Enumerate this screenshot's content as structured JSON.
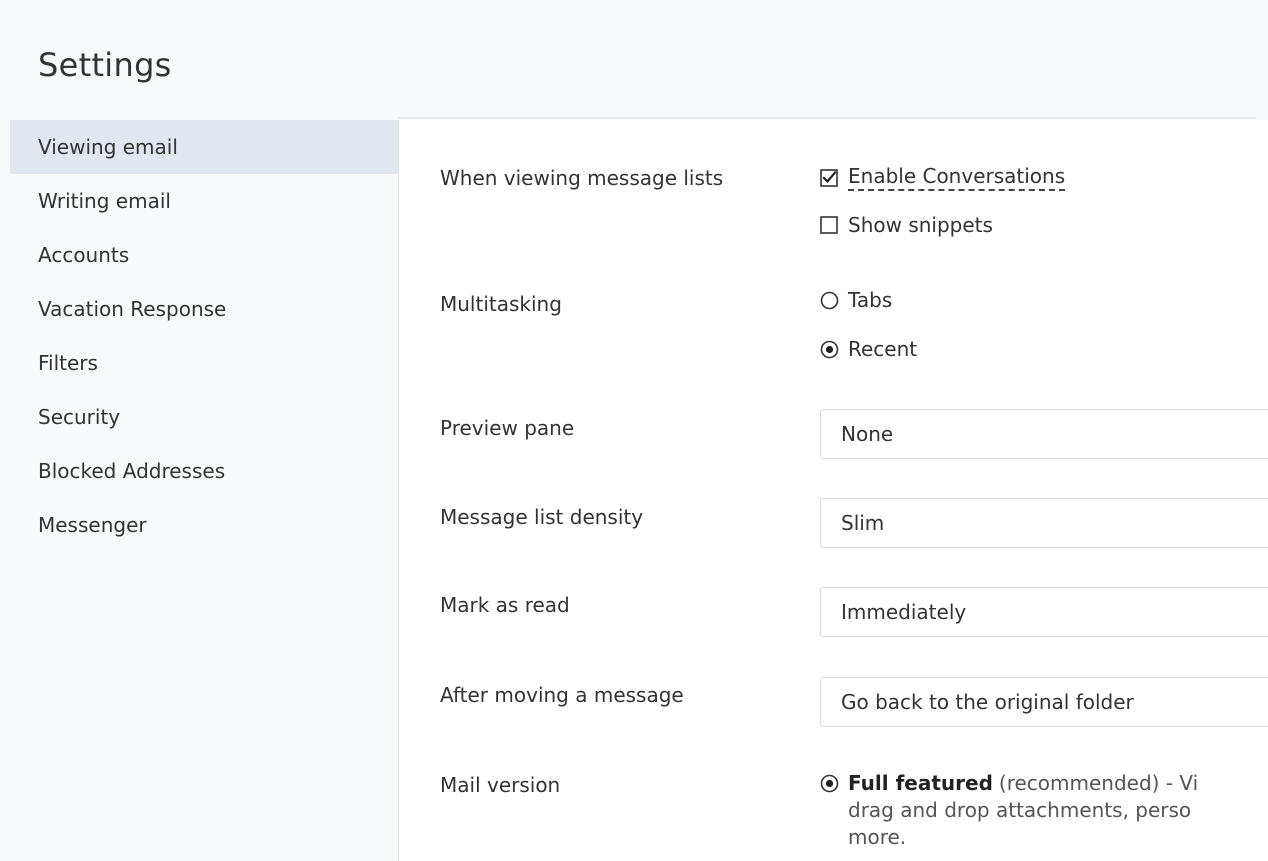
{
  "header": {
    "title": "Settings"
  },
  "sidebar": {
    "items": [
      {
        "label": "Viewing email",
        "active": true
      },
      {
        "label": "Writing email",
        "active": false
      },
      {
        "label": "Accounts",
        "active": false
      },
      {
        "label": "Vacation Response",
        "active": false
      },
      {
        "label": "Filters",
        "active": false
      },
      {
        "label": "Security",
        "active": false
      },
      {
        "label": "Blocked Addresses",
        "active": false
      },
      {
        "label": "Messenger",
        "active": false
      }
    ]
  },
  "settings": {
    "message_lists": {
      "label": "When viewing message lists",
      "options": [
        {
          "label": "Enable Conversations",
          "checked": true,
          "icon": "checkbox-checked-icon"
        },
        {
          "label": "Show snippets",
          "checked": false,
          "icon": "checkbox-empty-icon"
        }
      ]
    },
    "multitasking": {
      "label": "Multitasking",
      "options": [
        {
          "label": "Tabs",
          "selected": false,
          "icon": "radio-empty-icon"
        },
        {
          "label": "Recent",
          "selected": true,
          "icon": "radio-selected-icon"
        }
      ]
    },
    "preview_pane": {
      "label": "Preview pane",
      "value": "None"
    },
    "density": {
      "label": "Message list density",
      "value": "Slim"
    },
    "mark_as_read": {
      "label": "Mark as read",
      "value": "Immediately"
    },
    "after_moving": {
      "label": "After moving a message",
      "value": "Go back to the original folder"
    },
    "mail_version": {
      "label": "Mail version",
      "option_bold": "Full featured",
      "option_rest": "(recommended) - Vi",
      "line2": "drag and drop attachments, perso",
      "line3": "more.",
      "selected": true
    }
  },
  "colors": {
    "sidebar_bg": "#f8f9fb",
    "sidebar_active": "#e1e6ef",
    "text": "#333333",
    "border": "#d7dade"
  }
}
